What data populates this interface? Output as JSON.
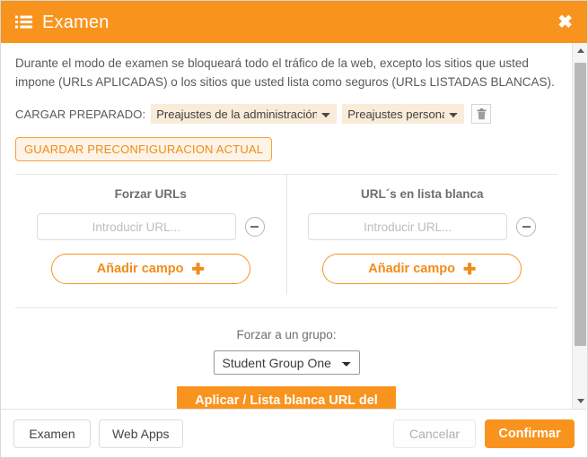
{
  "window": {
    "title": "Examen",
    "title_icon": "list-icon",
    "close_label": "✖"
  },
  "description": "Durante el modo de examen se bloqueará todo el tráfico de la web, excepto los sitios que usted impone (URLs APLICADAS) o los sitios que usted lista como seguros (URLs LISTADAS BLANCAS).",
  "presets": {
    "label": "CARGAR PREPARADO:",
    "admin_select": {
      "value": "Preajustes de la administración",
      "options": [
        "Preajustes de la administración"
      ]
    },
    "personal_select": {
      "value": "Preajustes personali",
      "options": [
        "Preajustes personali"
      ]
    },
    "delete_icon": "trash-icon",
    "save_button": "GUARDAR PRECONFIGURACION ACTUAL"
  },
  "columns": [
    {
      "title": "Forzar URLs",
      "input_placeholder": "Introducir URL...",
      "input_value": "",
      "remove_icon": "minus-circle-icon",
      "add_label": "Añadir campo",
      "add_icon": "plus-icon"
    },
    {
      "title": "URL´s en lista blanca",
      "input_placeholder": "Introducir URL...",
      "input_value": "",
      "remove_icon": "minus-circle-icon",
      "add_label": "Añadir campo",
      "add_icon": "plus-icon"
    }
  ],
  "group": {
    "label": "Forzar a un grupo:",
    "select": {
      "value": "Student Group One",
      "options": [
        "Student Group One"
      ]
    },
    "apply_button": "Aplicar / Lista blanca URL del grupo"
  },
  "footer": {
    "tabs": [
      "Examen",
      "Web Apps"
    ],
    "cancel_label": "Cancelar",
    "confirm_label": "Confirmar"
  },
  "colors": {
    "accent": "#f8941e",
    "accent_text": "#f08c1a",
    "peach_field": "#faecd8",
    "text": "#58595b",
    "muted": "#bdbdbd"
  }
}
